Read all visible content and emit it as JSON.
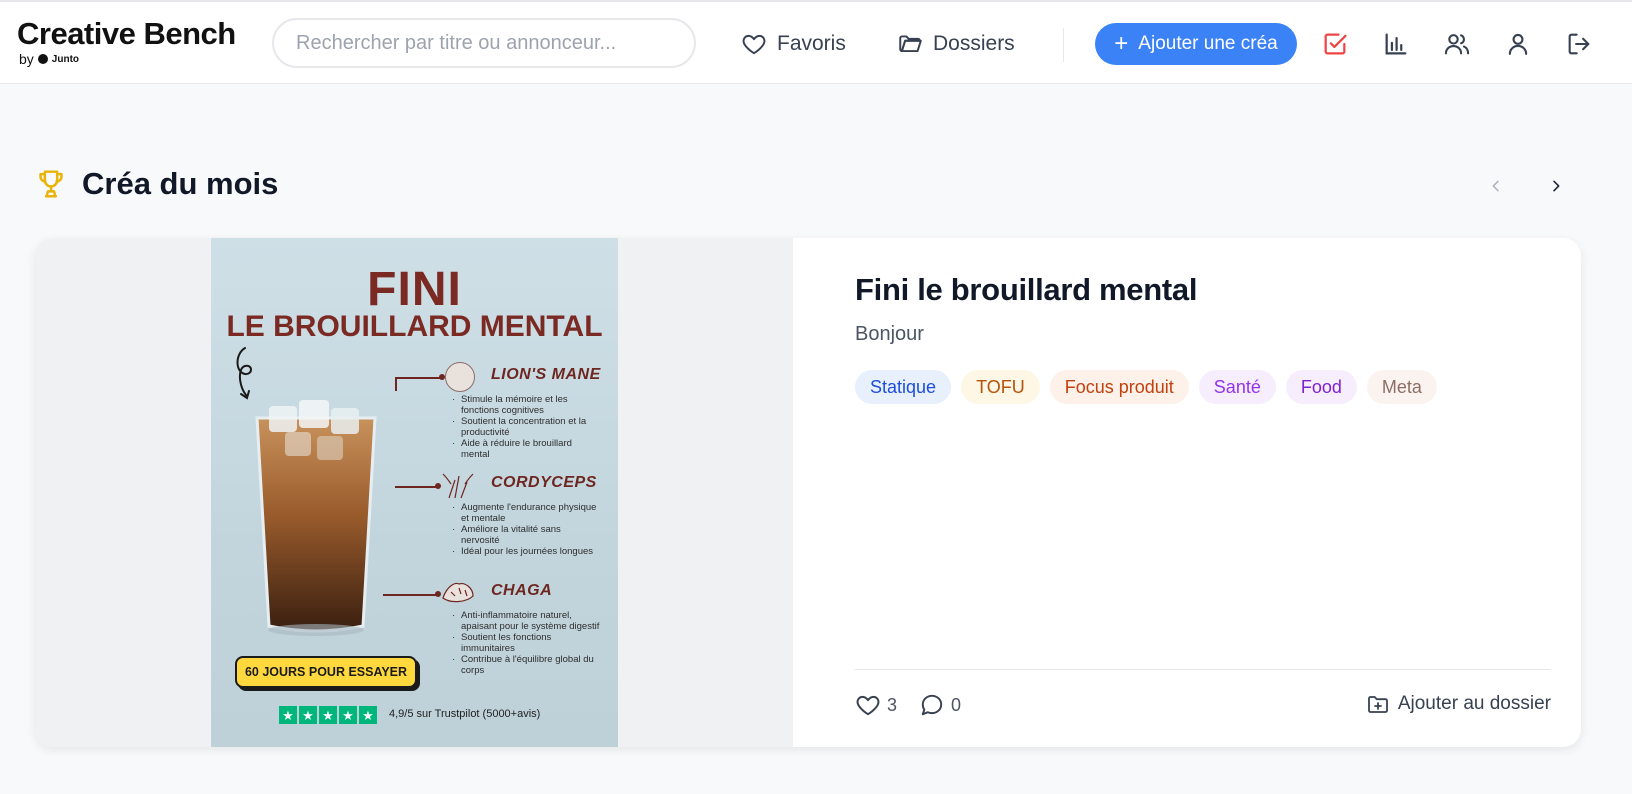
{
  "header": {
    "logo_title": "Creative Bench",
    "logo_by": "by",
    "logo_brand": "Junto",
    "search_placeholder": "Rechercher par titre ou annonceur...",
    "nav": [
      {
        "label": "Favoris",
        "icon": "heart-icon"
      },
      {
        "label": "Dossiers",
        "icon": "folder-icon"
      }
    ],
    "add_button": "Ajouter une créa",
    "icons": [
      "checkbox-icon",
      "bar-chart-icon",
      "users-icon",
      "user-icon",
      "logout-icon"
    ],
    "accent": "#3b82f6",
    "check_color": "#ef4444"
  },
  "section": {
    "title": "Créa du mois",
    "icon": "trophy-icon",
    "icon_color": "#eab308"
  },
  "card": {
    "ad": {
      "headline": "FINI",
      "subheadline": "LE BROUILLARD MENTAL",
      "ingredients": [
        {
          "name": "LION'S MANE",
          "points": [
            "Stimule la mémoire et les fonctions cognitives",
            "Soutient la concentration et la productivité",
            "Aide à réduire le brouillard mental"
          ]
        },
        {
          "name": "CORDYCEPS",
          "points": [
            "Augmente l'endurance physique et mentale",
            "Améliore la vitalité sans nervosité",
            "Idéal pour les journées longues"
          ]
        },
        {
          "name": "CHAGA",
          "points": [
            "Anti-inflammatoire naturel, apaisant pour le système digestif",
            "Soutient les fonctions immunitaires",
            "Contribue à l'équilibre global du corps"
          ]
        }
      ],
      "cta": "60 JOURS POUR ESSAYER",
      "rating": "4,9/5 sur Trustpilot (5000+avis)"
    },
    "title": "Fini le brouillard mental",
    "subtitle": "Bonjour",
    "tags": [
      {
        "label": "Statique",
        "bg": "#e8f0fe",
        "fg": "#1d4ed8"
      },
      {
        "label": "TOFU",
        "bg": "#fef7e6",
        "fg": "#b45309"
      },
      {
        "label": "Focus produit",
        "bg": "#fdf1ea",
        "fg": "#c2410c"
      },
      {
        "label": "Santé",
        "bg": "#f6eefd",
        "fg": "#9333ea"
      },
      {
        "label": "Food",
        "bg": "#f6eefd",
        "fg": "#7e22ce"
      },
      {
        "label": "Meta",
        "bg": "#fbf3f0",
        "fg": "#8b6f66"
      }
    ],
    "likes": "3",
    "comments": "0",
    "add_to_folder": "Ajouter au dossier"
  }
}
